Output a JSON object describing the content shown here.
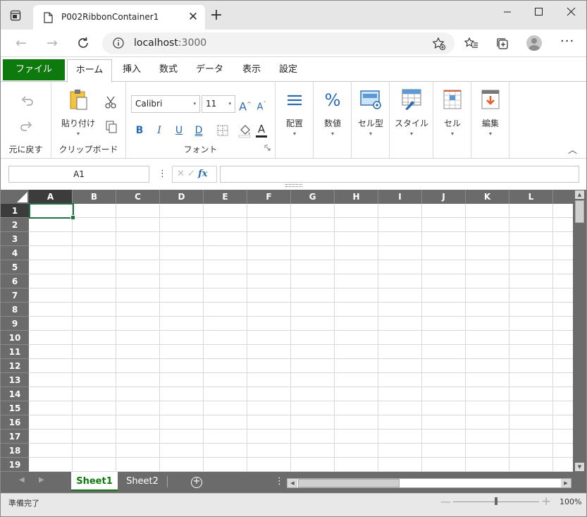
{
  "browser": {
    "tab_title": "P002RibbonContainer1",
    "close_glyph": "✕",
    "newtab_glyph": "+",
    "url_host": "localhost",
    "url_port": ":3000",
    "back_glyph": "←",
    "forward_glyph": "→",
    "more_glyph": "···"
  },
  "ribbon_tabs": {
    "file": "ファイル",
    "home": "ホーム",
    "insert": "挿入",
    "formulas": "数式",
    "data": "データ",
    "view": "表示",
    "settings": "設定"
  },
  "ribbon": {
    "undo_group": "元に戻す",
    "clipboard_group": "クリップボード",
    "paste_label": "貼り付け",
    "font_group": "フォント",
    "font_name": "Calibri",
    "font_size": "11",
    "bold": "B",
    "italic": "I",
    "underline": "U",
    "double_underline": "D",
    "font_color_letter": "A",
    "grow_font": "A",
    "shrink_font": "A",
    "align_label": "配置",
    "number_label": "数値",
    "cellstyle_label": "セル型",
    "style_label": "スタイル",
    "cells_label": "セル",
    "editing_label": "編集",
    "dropdown_glyph": "▾",
    "collapse_glyph": "︿"
  },
  "formula_bar": {
    "name_box": "A1",
    "dots": "⋮",
    "cancel": "✕",
    "enter": "✓",
    "fx": "fx",
    "formula": ""
  },
  "sheet": {
    "columns": [
      "A",
      "B",
      "C",
      "D",
      "E",
      "F",
      "G",
      "H",
      "I",
      "J",
      "K",
      "L"
    ],
    "rows": [
      "1",
      "2",
      "3",
      "4",
      "5",
      "6",
      "7",
      "8",
      "9",
      "10",
      "11",
      "12",
      "13",
      "14",
      "15",
      "16",
      "17",
      "18",
      "19"
    ],
    "active_cell": "A1"
  },
  "sheet_tabs": {
    "tabs": [
      "Sheet1",
      "Sheet2"
    ],
    "active": "Sheet1",
    "add_glyph": "+",
    "prev_glyph": "◀",
    "next_glyph": "▶",
    "vdots": "⋮"
  },
  "status": {
    "text": "準備完了",
    "zoom_minus": "—",
    "zoom_plus": "+",
    "zoom": "100%",
    "zoom_level": 1.0
  },
  "colors": {
    "accent": "#0e7a0d",
    "header_bg": "#6b6b6b",
    "active_cell": "#217346"
  }
}
